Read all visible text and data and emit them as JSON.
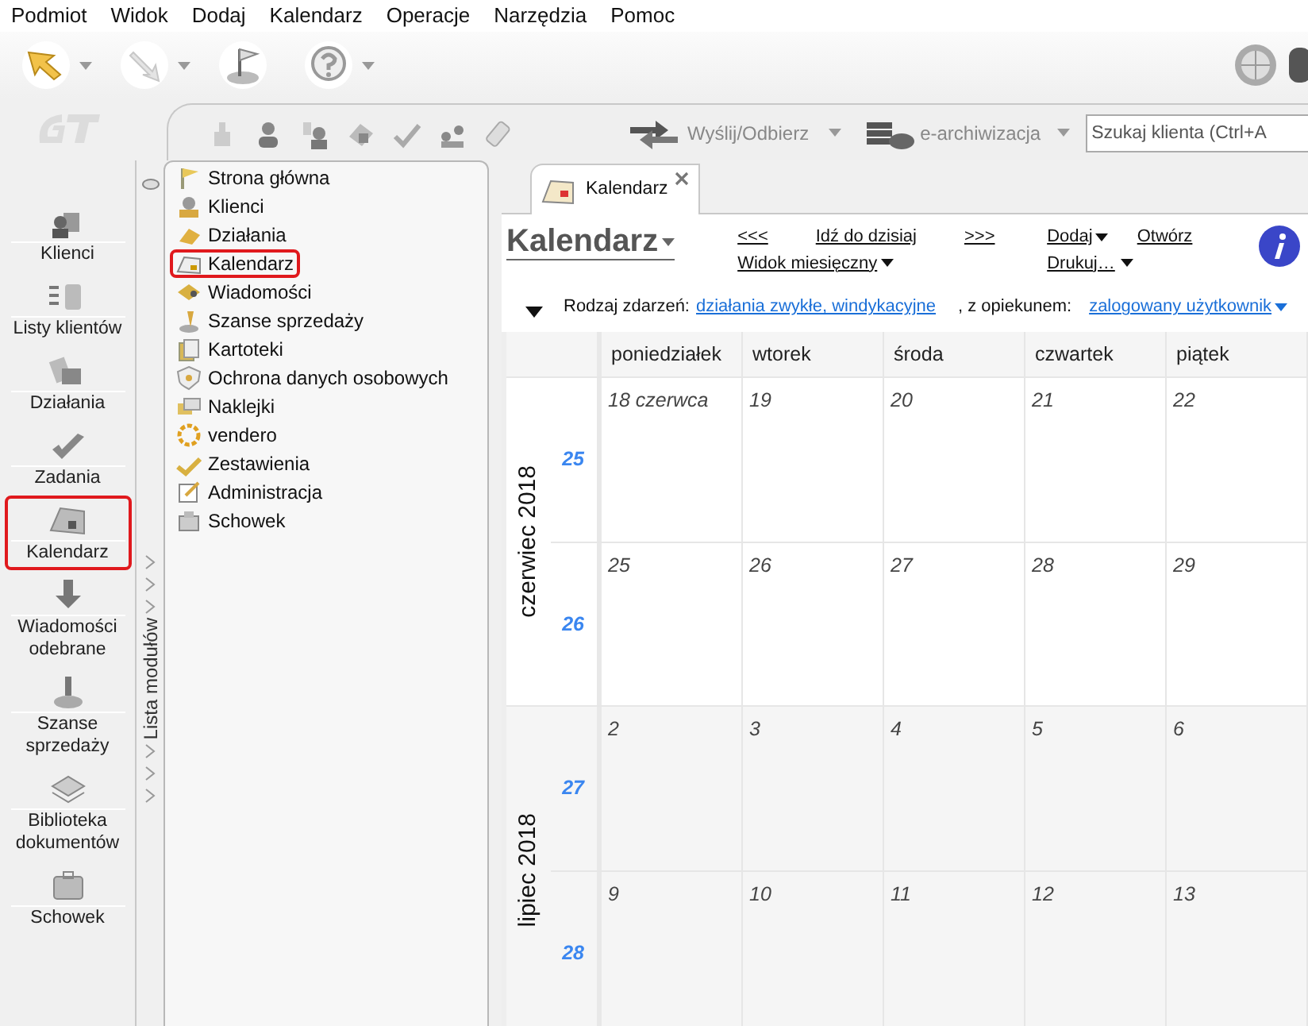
{
  "menu": [
    "Podmiot",
    "Widok",
    "Dodaj",
    "Kalendarz",
    "Operacje",
    "Narzędzia",
    "Pomoc"
  ],
  "module_toolbar": {
    "send_receive": "Wyślij/Odbierz",
    "archive": "e-archiwizacja",
    "search": {
      "placeholder": "Szukaj klienta (Ctrl+A"
    }
  },
  "nav_items": [
    {
      "label": "Klienci",
      "selected": false
    },
    {
      "label": "Listy klientów",
      "selected": false
    },
    {
      "label": "Działania",
      "selected": false
    },
    {
      "label": "Zadania",
      "selected": false
    },
    {
      "label": "Kalendarz",
      "selected": true
    },
    {
      "label": "Wiadomości odebrane",
      "selected": false
    },
    {
      "label": "Szanse sprzedaży",
      "selected": false
    },
    {
      "label": "Biblioteka dokumentów",
      "selected": false
    },
    {
      "label": "Schowek",
      "selected": false
    }
  ],
  "module_strip": {
    "label": "Lista modułów"
  },
  "modules": [
    {
      "label": "Strona główna",
      "selected": false
    },
    {
      "label": "Klienci",
      "selected": false
    },
    {
      "label": "Działania",
      "selected": false
    },
    {
      "label": "Kalendarz",
      "selected": true
    },
    {
      "label": "Wiadomości",
      "selected": false
    },
    {
      "label": "Szanse sprzedaży",
      "selected": false
    },
    {
      "label": "Kartoteki",
      "selected": false
    },
    {
      "label": "Ochrona danych osobowych",
      "selected": false
    },
    {
      "label": "Naklejki",
      "selected": false
    },
    {
      "label": "vendero",
      "selected": false
    },
    {
      "label": "Zestawienia",
      "selected": false
    },
    {
      "label": "Administracja",
      "selected": false
    },
    {
      "label": "Schowek",
      "selected": false
    }
  ],
  "tab": {
    "label": "Kalendarz"
  },
  "calendar": {
    "title": "Kalendarz",
    "nav": [
      "<<<",
      "Idź do dzisiaj",
      ">>>"
    ],
    "view": "Widok miesięczny",
    "actions": {
      "add": "Dodaj",
      "open": "Otwórz",
      "print": "Drukuj…"
    },
    "filter": {
      "label": "Rodzaj zdarzeń:",
      "value": "działania zwykłe, windykacyjne",
      "owner_label": ", z opiekunem:",
      "owner_value": "zalogowany użytkownik"
    },
    "weekdays": [
      "poniedziałek",
      "wtorek",
      "środa",
      "czwartek",
      "piątek"
    ],
    "months": [
      {
        "label": "czerwiec 2018",
        "weeks": [
          {
            "number": "25",
            "days": [
              "18 czerwca",
              "19",
              "20",
              "21",
              "22"
            ]
          },
          {
            "number": "26",
            "days": [
              "25",
              "26",
              "27",
              "28",
              "29"
            ]
          }
        ]
      },
      {
        "label": "lipiec 2018",
        "weeks": [
          {
            "number": "27",
            "days": [
              "2",
              "3",
              "4",
              "5",
              "6"
            ]
          },
          {
            "number": "28",
            "days": [
              "9",
              "10",
              "11",
              "12",
              "13"
            ]
          }
        ]
      }
    ]
  }
}
